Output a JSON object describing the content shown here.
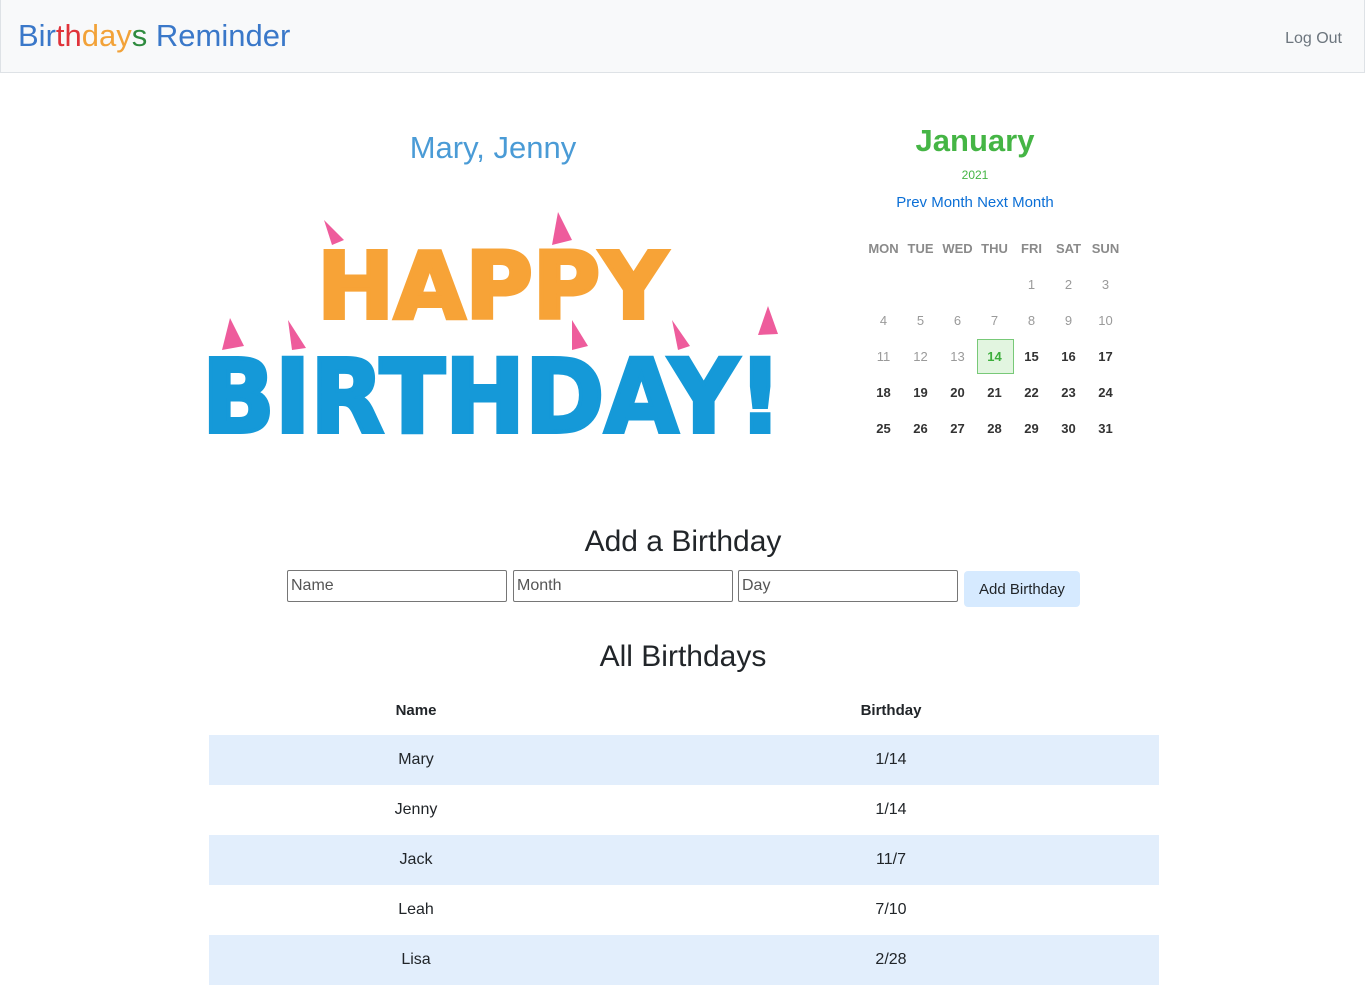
{
  "navbar": {
    "brand_letters": [
      {
        "t": "Bir",
        "c": "#3a78c9"
      },
      {
        "t": "t",
        "c": "#e0333a"
      },
      {
        "t": "h",
        "c": "#e0333a"
      },
      {
        "t": "d",
        "c": "#f2a238"
      },
      {
        "t": "a",
        "c": "#f2a238"
      },
      {
        "t": "y",
        "c": "#f2a238"
      },
      {
        "t": "s",
        "c": "#2e8b3e"
      },
      {
        "t": " Reminder",
        "c": "#3a78c9"
      }
    ],
    "logout": "Log Out"
  },
  "today_birthdays": "Mary, Jenny",
  "banner": {
    "happy": "HAPPY",
    "birthday": "BIRTHDAY!"
  },
  "calendar": {
    "month": "January",
    "year": "2021",
    "prev": "Prev Month",
    "next": "Next Month",
    "weekdays": [
      "MON",
      "TUE",
      "WED",
      "THU",
      "FRI",
      "SAT",
      "SUN"
    ],
    "weeks": [
      [
        "",
        "",
        "",
        "",
        "1",
        "2",
        "3"
      ],
      [
        "4",
        "5",
        "6",
        "7",
        "8",
        "9",
        "10"
      ],
      [
        "11",
        "12",
        "13",
        "14",
        "15",
        "16",
        "17"
      ],
      [
        "18",
        "19",
        "20",
        "21",
        "22",
        "23",
        "24"
      ],
      [
        "25",
        "26",
        "27",
        "28",
        "29",
        "30",
        "31"
      ]
    ],
    "today": "14"
  },
  "add_form": {
    "title": "Add a Birthday",
    "name_placeholder": "Name",
    "month_placeholder": "Month",
    "day_placeholder": "Day",
    "button": "Add Birthday"
  },
  "list": {
    "title": "All Birthdays",
    "columns": [
      "Name",
      "Birthday"
    ],
    "rows": [
      [
        "Mary",
        "1/14"
      ],
      [
        "Jenny",
        "1/14"
      ],
      [
        "Jack",
        "11/7"
      ],
      [
        "Leah",
        "7/10"
      ],
      [
        "Lisa",
        "2/28"
      ]
    ]
  },
  "colors": {
    "banner_orange": "#f7a337",
    "banner_blue": "#1599d8",
    "hat_pink": "#ee5c9c"
  }
}
